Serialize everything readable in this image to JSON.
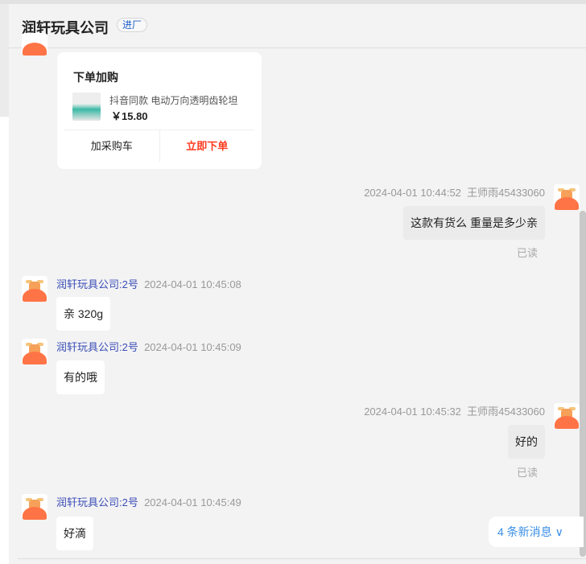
{
  "header": {
    "title": "润轩玩具公司",
    "tag": "进厂"
  },
  "card": {
    "title": "下单加购",
    "product_name": "抖音同款 电动万向透明齿轮坦",
    "price": "￥15.80",
    "add_cart": "加采购车",
    "buy_now": "立即下单"
  },
  "messages": [
    {
      "time": "2024-04-01 10:44:52",
      "sender": "王师雨45433060",
      "text": "这款有货么 重量是多少亲",
      "status": "已读"
    },
    {
      "sender": "润轩玩具公司:2号",
      "time": "2024-04-01 10:45:08",
      "text": "亲 320g"
    },
    {
      "sender": "润轩玩具公司:2号",
      "time": "2024-04-01 10:45:09",
      "text": "有的哦"
    },
    {
      "time": "2024-04-01 10:45:32",
      "sender": "王师雨45433060",
      "text": "好的",
      "status": "已读"
    },
    {
      "sender": "润轩玩具公司:2号",
      "time": "2024-04-01 10:45:49",
      "text": "好滴"
    }
  ],
  "new_messages": {
    "label": "4 条新消息",
    "chevron": "∨"
  }
}
